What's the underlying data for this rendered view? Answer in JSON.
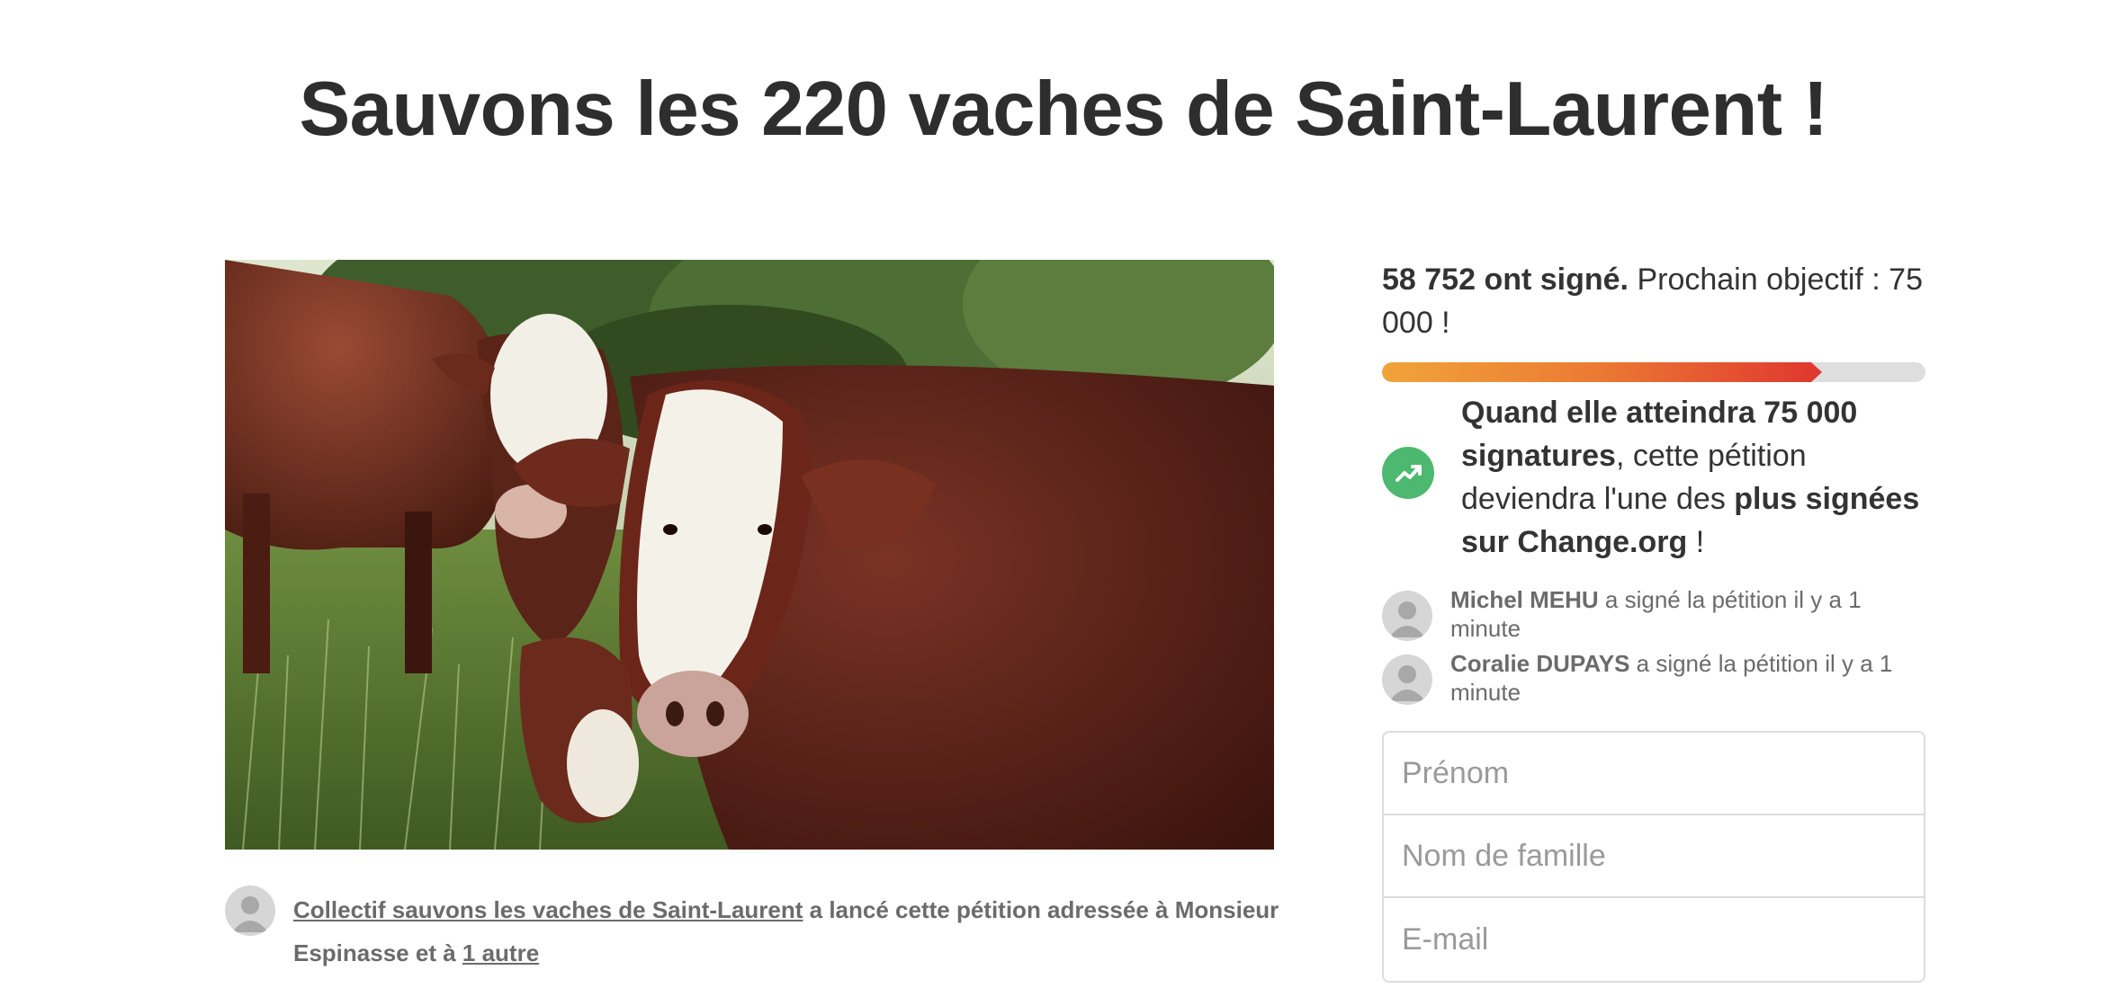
{
  "petition": {
    "title": "Sauvons les 220 vaches de Saint-Laurent !",
    "image_description": "cows-photo",
    "starter": {
      "name": "Collectif sauvons les vaches de Saint-Laurent",
      "text": "a lancé cette pétition adressée à Monsieur Espinasse et à",
      "others_link": "1 autre"
    }
  },
  "signatures": {
    "count_text": "58 752 ont signé.",
    "goal_text": "Prochain objectif : 75 000 !",
    "progress_fraction": 0.79
  },
  "milestone": {
    "icon": "trending-up-icon",
    "bold_1": "Quand elle atteindra 75 000 signatures",
    "text_1": ", cette pétition deviendra l'une des ",
    "bold_2": "plus signées sur Change.org",
    "text_2": " !"
  },
  "recent_signers": [
    {
      "name": "Michel MEHU",
      "text": "a signé la pétition il y a 1 minute"
    },
    {
      "name": "Coralie DUPAYS",
      "text": "a signé la pétition il y a 1 minute"
    }
  ],
  "form": {
    "first_name_placeholder": "Prénom",
    "last_name_placeholder": "Nom de famille",
    "email_placeholder": "E-mail"
  },
  "colors": {
    "progress_start": "#f0a43a",
    "progress_end": "#e0392f",
    "milestone_green": "#4cb870"
  }
}
